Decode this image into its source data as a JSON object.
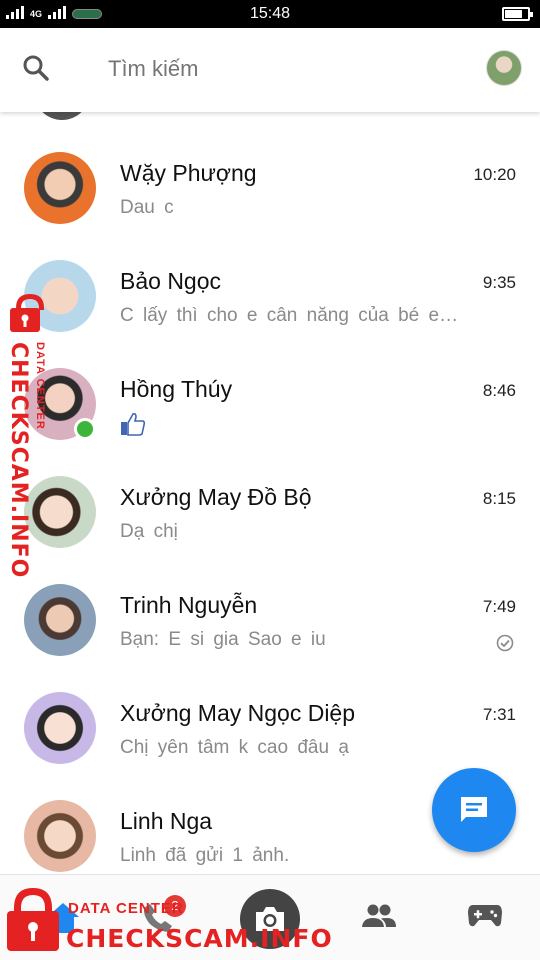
{
  "status_bar": {
    "network": "4G",
    "time": "15:48"
  },
  "header": {
    "search_placeholder": "Tìm kiếm"
  },
  "conversations": [
    {
      "name": "Wặy Phượng",
      "preview": "Dau c",
      "time": "10:20"
    },
    {
      "name": "Bảo Ngọc",
      "preview": "C lấy thì cho e cân năng của bé e…",
      "time": "9:35"
    },
    {
      "name": "Hồng Thúy",
      "preview": "",
      "time": "8:46",
      "online": true,
      "preview_icon": "thumbs-up-icon"
    },
    {
      "name": "Xưởng May Đồ Bộ",
      "preview": "Dạ chị",
      "time": "8:15"
    },
    {
      "name": "Trinh Nguyễn",
      "preview": "Bạn: E si gia Sao e iu",
      "time": "7:49",
      "status_icon": "seen-check-icon"
    },
    {
      "name": "Xưởng May Ngọc Diệp",
      "preview": "Chị yên tâm k cao đâu ạ",
      "time": "7:31"
    },
    {
      "name": "Linh Nga",
      "preview": "Linh đã gửi 1 ảnh.",
      "time": ""
    }
  ],
  "bottom_nav": {
    "calls_badge": "2",
    "icons": [
      "home-icon",
      "phone-icon",
      "camera-icon",
      "people-icon",
      "games-icon"
    ]
  },
  "watermark": {
    "small_text": "DATA CENTER",
    "big_text": "CHECKSCAM.INFO"
  },
  "colors": {
    "accent": "#1e88f0",
    "online": "#3cb53a",
    "badge": "#e53935",
    "watermark": "#e52222"
  }
}
